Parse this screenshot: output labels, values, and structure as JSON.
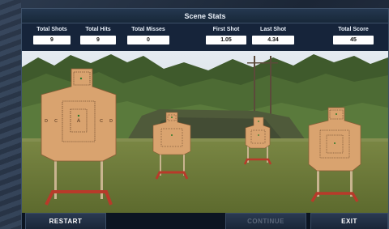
{
  "title": "Scene Stats",
  "stats": [
    {
      "label": "Total Shots",
      "value": "9"
    },
    {
      "label": "Total Hits",
      "value": "9"
    },
    {
      "label": "Total Misses",
      "value": "0"
    },
    {
      "label": "First Shot",
      "value": "1.05"
    },
    {
      "label": "Last Shot",
      "value": "4.34"
    },
    {
      "label": "Total Score",
      "value": "45"
    }
  ],
  "target_zone_letters": {
    "center": "A",
    "left": "C",
    "right": "C",
    "outer_left": "D",
    "outer_right": "D"
  },
  "buttons": {
    "restart": "RESTART",
    "continue": "CONTINUE",
    "exit": "EXIT"
  },
  "colors": {
    "target": "#d9a36f",
    "stand": "#b83a2a",
    "grass": "#6f7e3c",
    "sky": "#dfe6ee",
    "accent": "#2a3a52"
  }
}
